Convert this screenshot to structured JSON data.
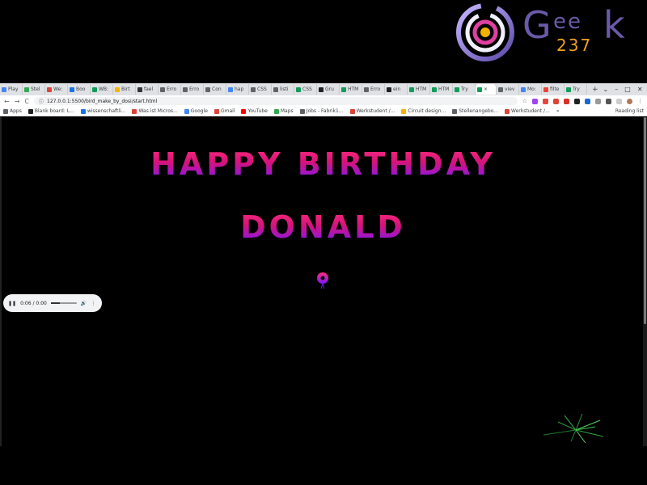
{
  "logo": {
    "g": "G",
    "ee": "ee",
    "num": "237",
    "k": "k"
  },
  "tabs": [
    {
      "label": "Play",
      "color": "#4285f4"
    },
    {
      "label": "Stel",
      "color": "#34a853"
    },
    {
      "label": "We:",
      "color": "#db4437"
    },
    {
      "label": "Boo",
      "color": "#1a73e8"
    },
    {
      "label": "WB:",
      "color": "#0f9d58"
    },
    {
      "label": "Birt",
      "color": "#f4b400"
    },
    {
      "label": "fael",
      "color": "#333333"
    },
    {
      "label": "Erro",
      "color": "#5f6368"
    },
    {
      "label": "Erro",
      "color": "#5f6368"
    },
    {
      "label": "Con",
      "color": "#5f6368"
    },
    {
      "label": "hap",
      "color": "#4285f4"
    },
    {
      "label": "CSS",
      "color": "#5f6368"
    },
    {
      "label": "listi",
      "color": "#5f6368"
    },
    {
      "label": "CSS",
      "color": "#0f9d58"
    },
    {
      "label": "Gru",
      "color": "#202124"
    },
    {
      "label": "HTM",
      "color": "#0f9d58"
    },
    {
      "label": "Erro",
      "color": "#5f6368"
    },
    {
      "label": "ein",
      "color": "#202124"
    },
    {
      "label": "HTM",
      "color": "#0f9d58"
    },
    {
      "label": "HTM",
      "color": "#0f9d58"
    },
    {
      "label": "Try",
      "color": "#0f9d58"
    }
  ],
  "active_tab": {
    "label": "×",
    "color": "#0f9d58"
  },
  "tabs_after": [
    {
      "label": "viev",
      "color": "#5f6368"
    },
    {
      "label": "Mo:",
      "color": "#4285f4"
    },
    {
      "label": "filte",
      "color": "#ea4335"
    },
    {
      "label": "Try",
      "color": "#0f9d58"
    }
  ],
  "new_tab": "+",
  "window_controls": {
    "minimize": "–",
    "maximize": "□",
    "close": "✕"
  },
  "toolbar": {
    "back": "←",
    "forward": "→",
    "reload": "C",
    "url": "127.0.0.1:5500/bird_make_by_dosi/start.html",
    "star": "☆",
    "menu": "⋮"
  },
  "bookmarks": [
    {
      "label": "Apps",
      "color": "#5f6368"
    },
    {
      "label": "Blank board: L...",
      "color": "#202124"
    },
    {
      "label": "wissenschaftli...",
      "color": "#1a73e8"
    },
    {
      "label": "Was ist Micros...",
      "color": "#db4437"
    },
    {
      "label": "Google",
      "color": "#4285f4"
    },
    {
      "label": "Gmail",
      "color": "#db4437"
    },
    {
      "label": "YouTube",
      "color": "#ff0000"
    },
    {
      "label": "Maps",
      "color": "#34a853"
    },
    {
      "label": "Jobs - Fabrik1...",
      "color": "#5f6368"
    },
    {
      "label": "Werkstudent /...",
      "color": "#db4437"
    },
    {
      "label": "Circuit design...",
      "color": "#f4b400"
    },
    {
      "label": "Stellenangebo...",
      "color": "#5f6368"
    },
    {
      "label": "Werkstudent /...",
      "color": "#db4437"
    }
  ],
  "reading_list": "Reading list",
  "greeting": {
    "line1": "HAPPY BIRTHDAY",
    "line2": "DONALD"
  },
  "audio": {
    "play_icon": "❚❚",
    "time": "0:06 / 0:00",
    "volume_icon": "🔊",
    "more": "⋮",
    "progress": 0.35
  },
  "colors": {
    "page_bg": "#000000",
    "text_top": "#ff2c7a",
    "text_bottom": "#7a18ff"
  }
}
